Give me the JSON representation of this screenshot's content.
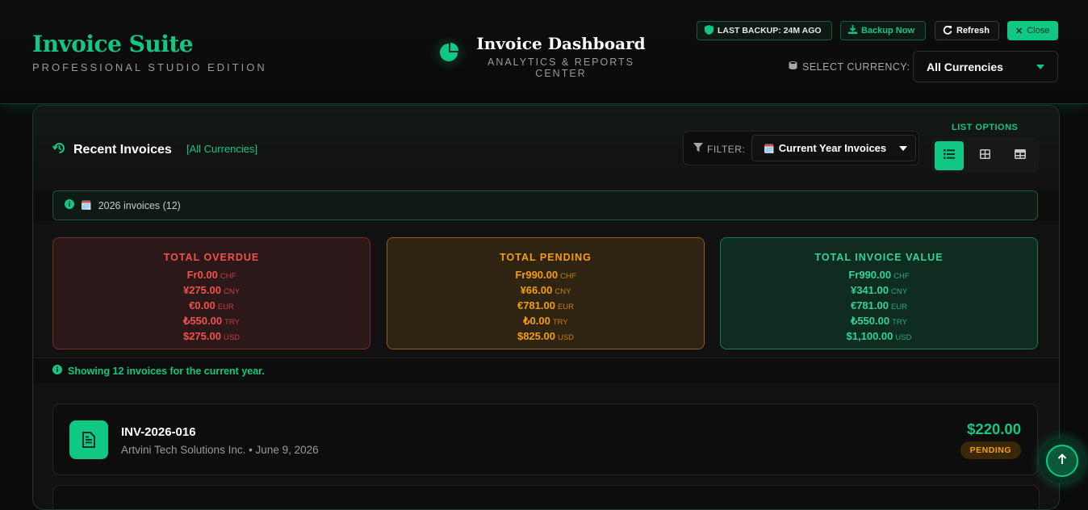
{
  "brand": {
    "title": "Invoice Suite",
    "subtitle": "PROFESSIONAL STUDIO EDITION"
  },
  "dashboard": {
    "title": "Invoice Dashboard",
    "subtitle": "ANALYTICS & REPORTS CENTER",
    "icon": "pie-chart-icon"
  },
  "toolbar": {
    "backup_status": "LAST BACKUP: 24M AGO",
    "backup_now": "Backup Now",
    "refresh": "Refresh",
    "close": "Close"
  },
  "currency": {
    "label": "SELECT CURRENCY:",
    "selected": "All Currencies"
  },
  "recent": {
    "title": "Recent Invoices",
    "tag": "[All Currencies]"
  },
  "filter": {
    "label": "FILTER:",
    "selected": "Current Year Invoices",
    "emoji": "🗓️"
  },
  "list_options": {
    "label": "LIST OPTIONS",
    "active_index": 0
  },
  "info": {
    "text": "2026 invoices (12)",
    "emoji": "🗓️"
  },
  "summary": {
    "overdue": {
      "title": "TOTAL OVERDUE",
      "lines": [
        {
          "amount": "Fr0.00",
          "code": "CHF"
        },
        {
          "amount": "¥275.00",
          "code": "CNY"
        },
        {
          "amount": "€0.00",
          "code": "EUR"
        },
        {
          "amount": "₺550.00",
          "code": "TRY"
        },
        {
          "amount": "$275.00",
          "code": "USD"
        }
      ]
    },
    "pending": {
      "title": "TOTAL PENDING",
      "lines": [
        {
          "amount": "Fr990.00",
          "code": "CHF"
        },
        {
          "amount": "¥66.00",
          "code": "CNY"
        },
        {
          "amount": "€781.00",
          "code": "EUR"
        },
        {
          "amount": "₺0.00",
          "code": "TRY"
        },
        {
          "amount": "$825.00",
          "code": "USD"
        }
      ]
    },
    "total": {
      "title": "TOTAL INVOICE VALUE",
      "lines": [
        {
          "amount": "Fr990.00",
          "code": "CHF"
        },
        {
          "amount": "¥341.00",
          "code": "CNY"
        },
        {
          "amount": "€781.00",
          "code": "EUR"
        },
        {
          "amount": "₺550.00",
          "code": "TRY"
        },
        {
          "amount": "$1,100.00",
          "code": "USD"
        }
      ]
    }
  },
  "note": "Showing 12 invoices for the current year.",
  "invoices": [
    {
      "number": "INV-2026-016",
      "client": "Artvini Tech Solutions Inc.",
      "date": "June 9, 2026",
      "meta": "Artvini Tech Solutions Inc. • June 9, 2026",
      "amount": "$220.00",
      "status": "PENDING"
    }
  ],
  "colors": {
    "accent": "#10c783",
    "overdue": "#f0524d",
    "pending": "#f59e0b",
    "total": "#34d399"
  }
}
